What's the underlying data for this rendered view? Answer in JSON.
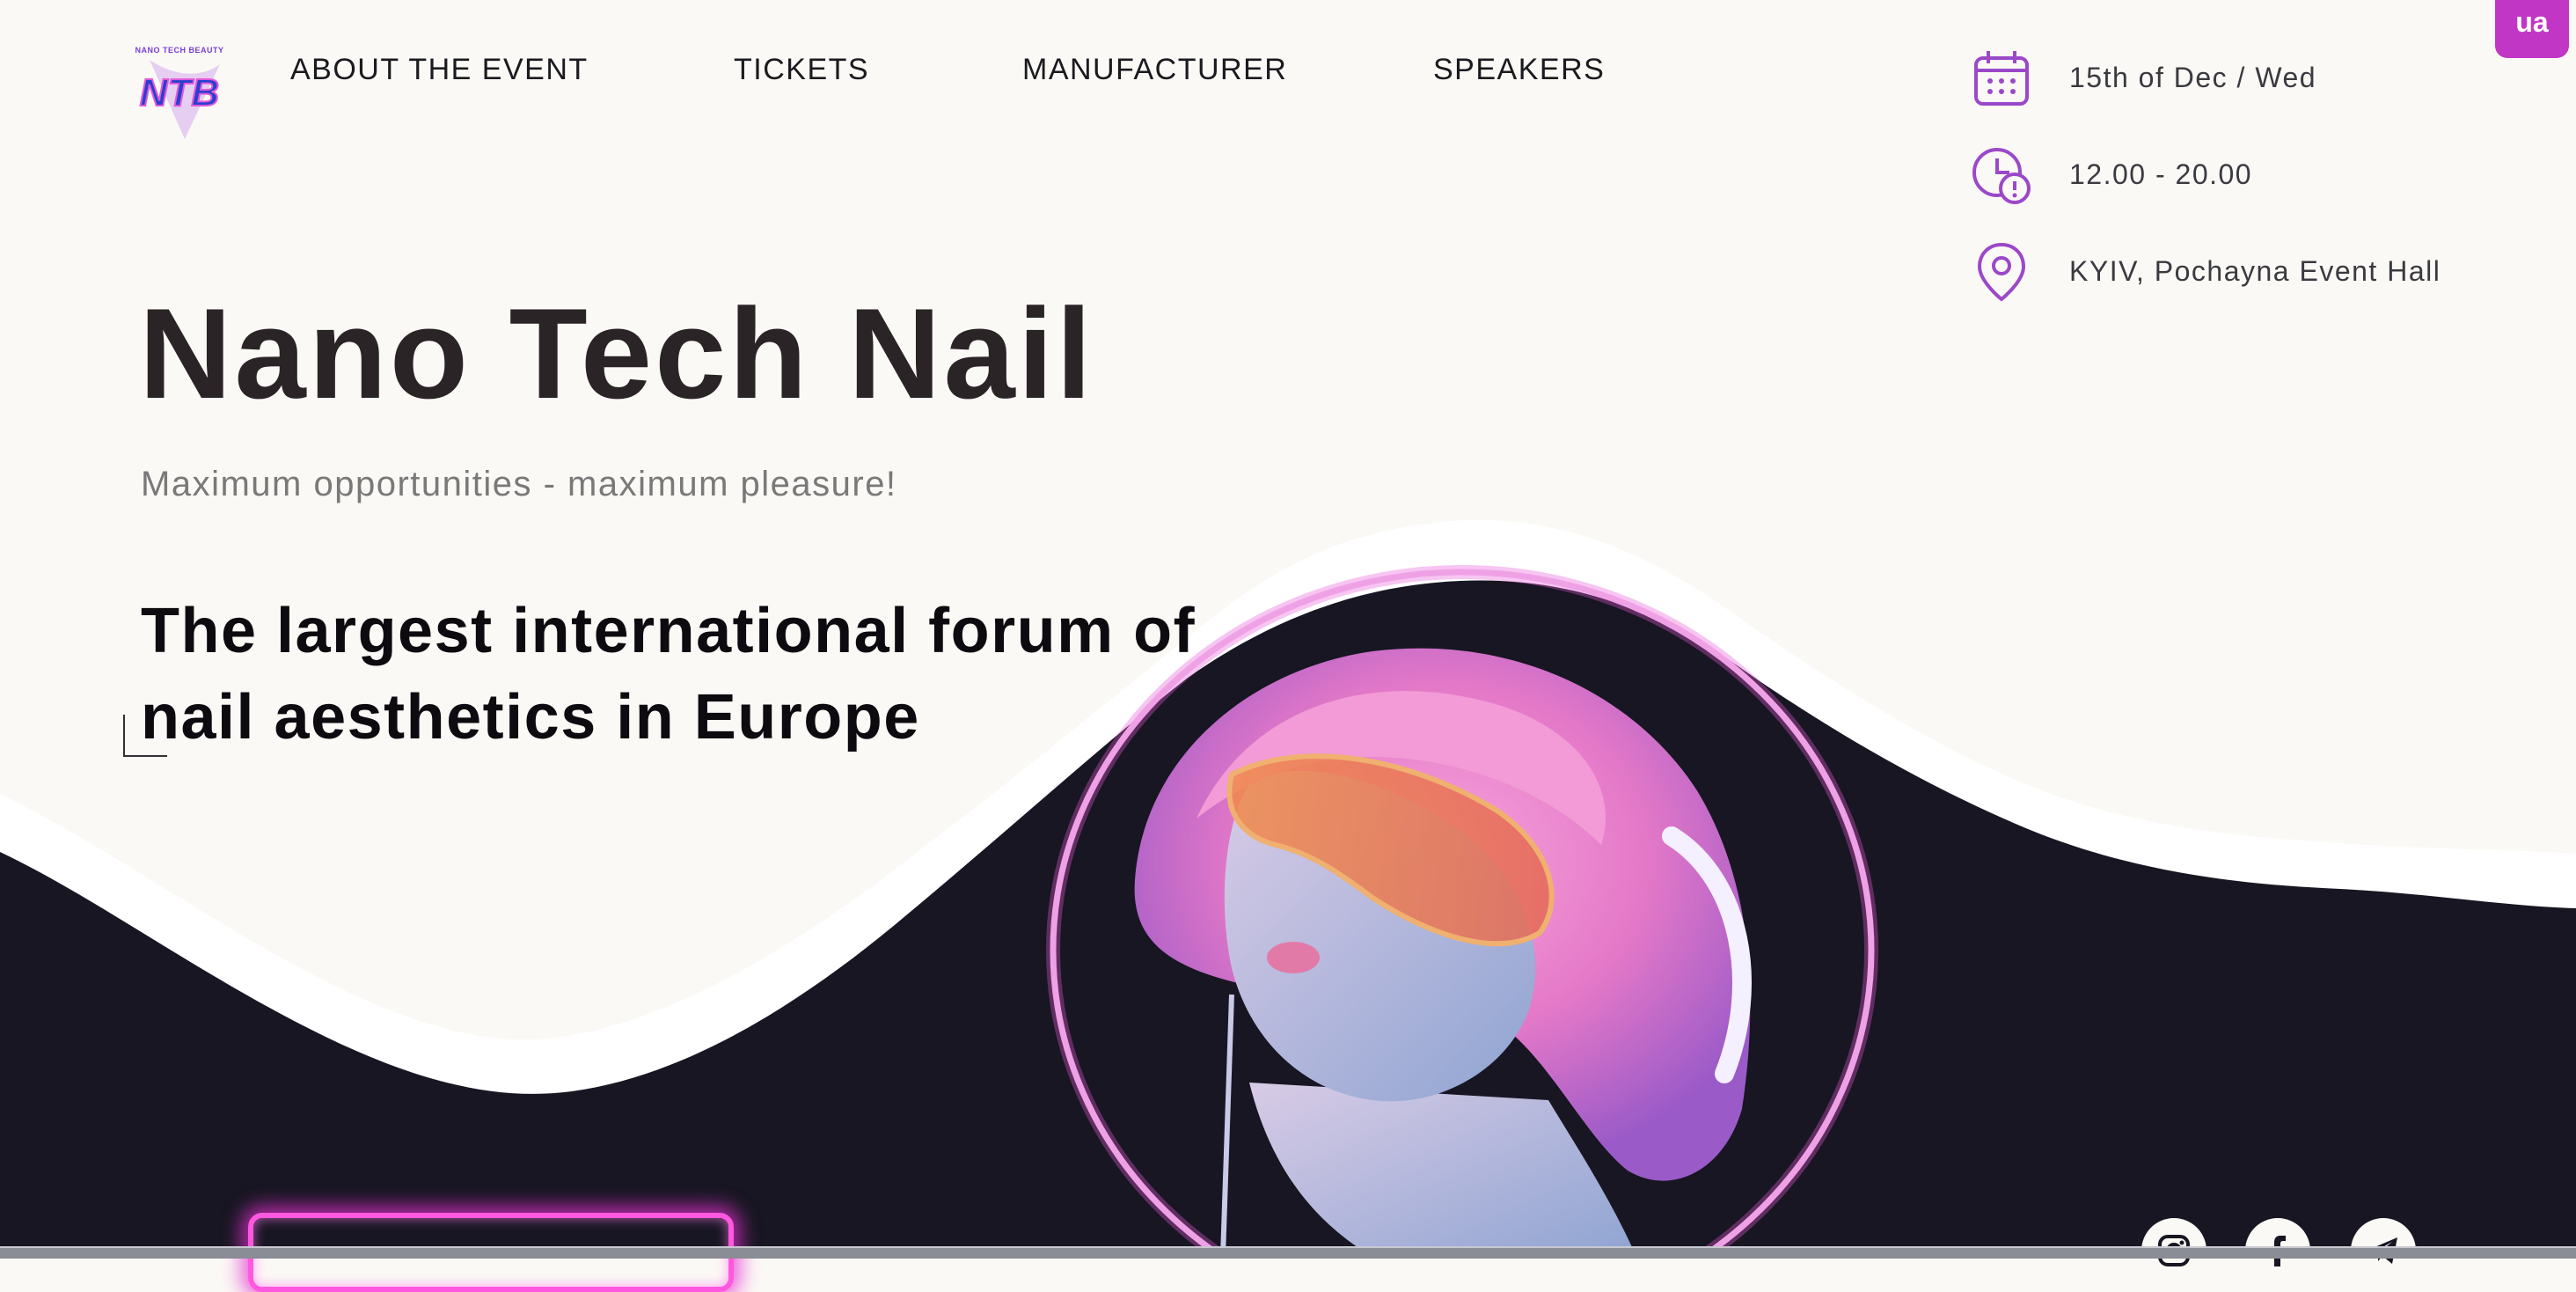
{
  "colors": {
    "background": "#fbf9f5",
    "dark_wave": "#171622",
    "accent": "#c236c6",
    "icon_purple": "#9b48c9",
    "hair_pink": "#f08bd0"
  },
  "logo": {
    "small_text": "NANO TECH BEAUTY",
    "mark": "NTB"
  },
  "nav": {
    "items": [
      {
        "label": "ABOUT THE EVENT"
      },
      {
        "label": "TICKETS"
      },
      {
        "label": "MANUFACTURER"
      },
      {
        "label": "SPEAKERS"
      }
    ]
  },
  "event_info": {
    "date": {
      "icon": "calendar-icon",
      "text": "15th of Dec / Wed"
    },
    "time": {
      "icon": "clock-icon",
      "text": "12.00 - 20.00"
    },
    "location": {
      "icon": "location-pin-icon",
      "text": "KYIV, Pochayna Event Hall"
    }
  },
  "language_button": {
    "label": "ua"
  },
  "hero": {
    "title": "Nano Tech Nail",
    "subtitle": "Maximum opportunities - maximum pleasure!",
    "tagline": "The largest international forum of nail aesthetics in Europe"
  },
  "social": [
    {
      "icon": "instagram-icon"
    },
    {
      "icon": "facebook-icon"
    },
    {
      "icon": "telegram-icon"
    }
  ]
}
